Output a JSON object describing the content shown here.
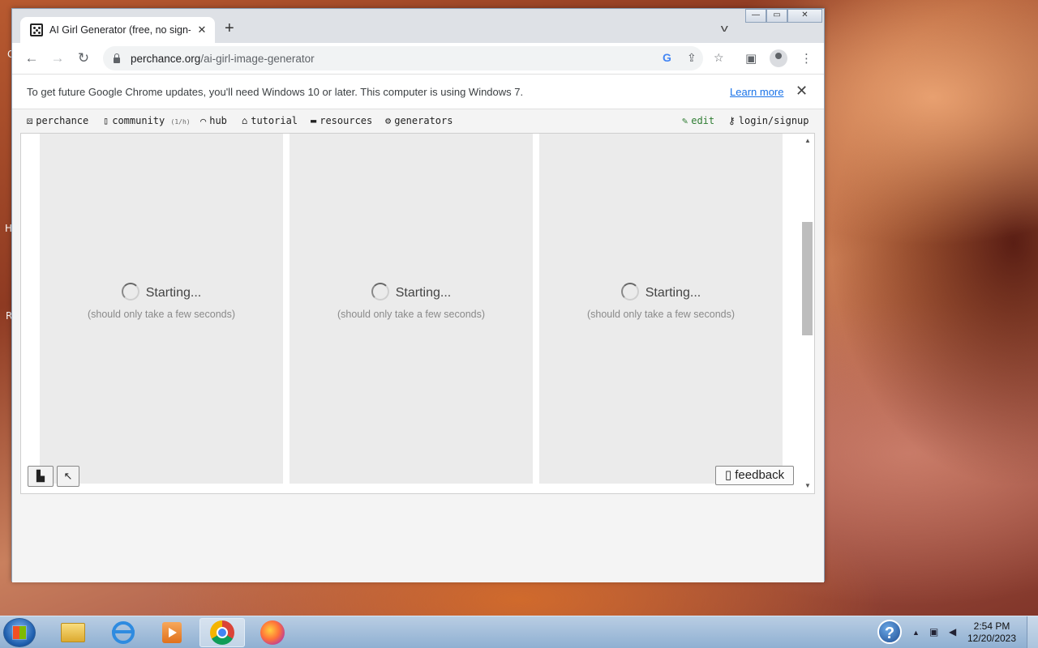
{
  "browser": {
    "tab_title": "AI Girl Generator (free, no sign-up",
    "url_host": "perchance.org",
    "url_path": "/ai-girl-image-generator",
    "window_buttons": {
      "minimize": "—",
      "maximize": "▭",
      "close": "✕"
    }
  },
  "infobar": {
    "message": "To get future Google Chrome updates, you'll need Windows 10 or later. This computer is using Windows 7.",
    "link": "Learn more"
  },
  "site_nav": {
    "perchance": "perchance",
    "community": "community",
    "community_badge": "(1/h)",
    "hub": "hub",
    "tutorial": "tutorial",
    "resources": "resources",
    "generators": "generators",
    "edit": "edit",
    "login": "login/signup"
  },
  "gallery": {
    "cards": [
      {
        "status": "Starting...",
        "subtext": "(should only take a few seconds)"
      },
      {
        "status": "Starting...",
        "subtext": "(should only take a few seconds)"
      },
      {
        "status": "Starting...",
        "subtext": "(should only take a few seconds)"
      }
    ],
    "feedback_label": "feedback"
  },
  "desktop_edge_letters": [
    "C",
    "H",
    "R"
  ],
  "taskbar": {
    "time": "2:54 PM",
    "date": "12/20/2023",
    "help": "?"
  }
}
